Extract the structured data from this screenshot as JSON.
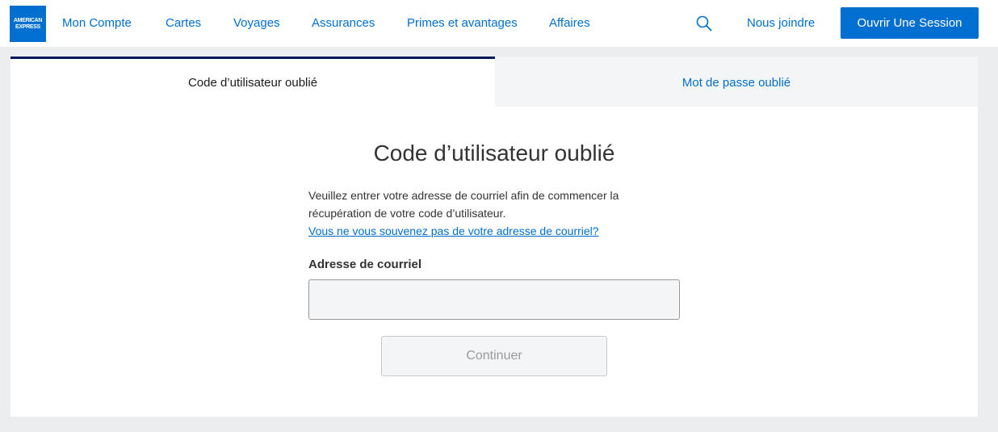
{
  "brand": {
    "logo_line1": "AMERICAN",
    "logo_line2": "EXPRESS",
    "color": "#016fd0"
  },
  "nav": {
    "items": [
      {
        "label": "Mon Compte"
      },
      {
        "label": "Cartes"
      },
      {
        "label": "Voyages"
      },
      {
        "label": "Assurances"
      },
      {
        "label": "Primes et avantages"
      },
      {
        "label": "Affaires"
      }
    ],
    "search_icon": "search-icon",
    "contact_label": "Nous joindre",
    "login_label": "Ouvrir Une Session"
  },
  "tabs": [
    {
      "label": "Code d’utilisateur oublié",
      "active": true
    },
    {
      "label": "Mot de passe oublié",
      "active": false
    }
  ],
  "form": {
    "title": "Code d’utilisateur oublié",
    "description": "Veuillez entrer votre adresse de courriel afin de commencer la récupération de votre code d’utilisateur.",
    "help_link": "Vous ne vous souvenez pas de votre adresse de courriel?",
    "email_label": "Adresse de courriel",
    "email_value": "",
    "continue_label": "Continuer"
  },
  "colors": {
    "accent": "#006fcf",
    "active_tab_border": "#00175a",
    "page_background": "#ecedee"
  }
}
